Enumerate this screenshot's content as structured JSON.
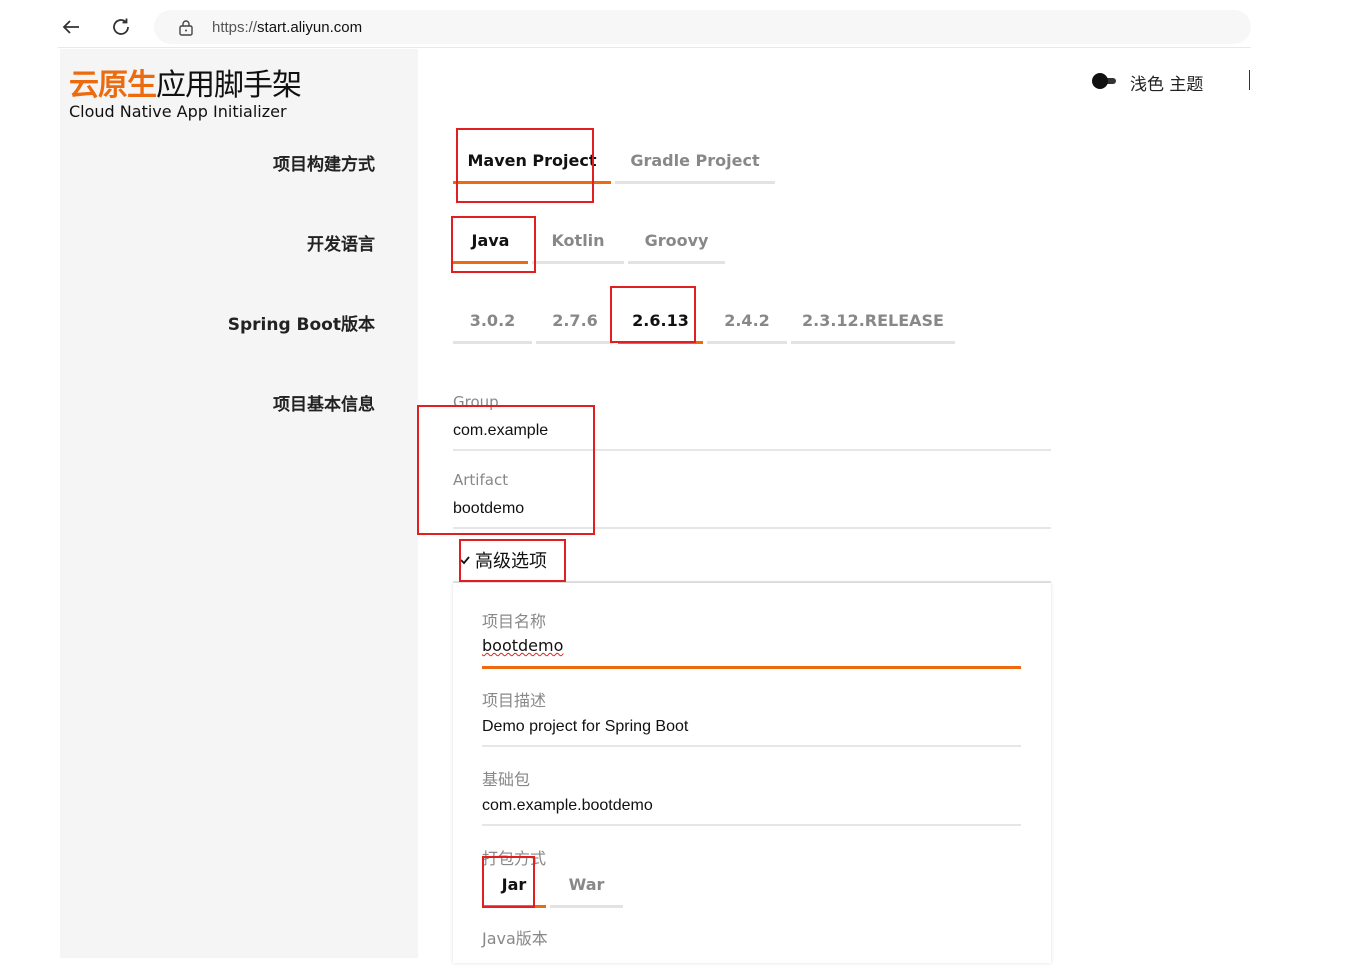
{
  "browser": {
    "url_prefix": "https://",
    "url_host": "start.aliyun.com"
  },
  "logo": {
    "cn_orange": "云原生",
    "cn_dark": "应用脚手架",
    "en": "Cloud Native App Initializer"
  },
  "theme": {
    "label": "浅色 主题"
  },
  "sections": {
    "build": {
      "label": "项目构建方式",
      "options": [
        "Maven Project",
        "Gradle Project"
      ],
      "selected": "Maven Project"
    },
    "language": {
      "label": "开发语言",
      "options": [
        "Java",
        "Kotlin",
        "Groovy"
      ],
      "selected": "Java"
    },
    "boot": {
      "label": "Spring Boot版本",
      "options": [
        "3.0.2",
        "2.7.6",
        "2.6.13",
        "2.4.2",
        "2.3.12.RELEASE"
      ],
      "selected": "2.6.13"
    },
    "info": {
      "label": "项目基本信息",
      "group_label": "Group",
      "group_value": "com.example",
      "artifact_label": "Artifact",
      "artifact_value": "bootdemo"
    }
  },
  "advanced": {
    "toggle_label": "高级选项",
    "name_label": "项目名称",
    "name_value": "bootdemo",
    "desc_label": "项目描述",
    "desc_value": "Demo project for Spring Boot",
    "package_label": "基础包",
    "package_value": "com.example.bootdemo",
    "packaging_label": "打包方式",
    "packaging_options": [
      "Jar",
      "War"
    ],
    "packaging_selected": "Jar",
    "java_label": "Java版本"
  },
  "colors": {
    "accent": "#ec6b0e",
    "highlight_box": "#e02020",
    "sidebar_bg": "#f5f5f5"
  }
}
